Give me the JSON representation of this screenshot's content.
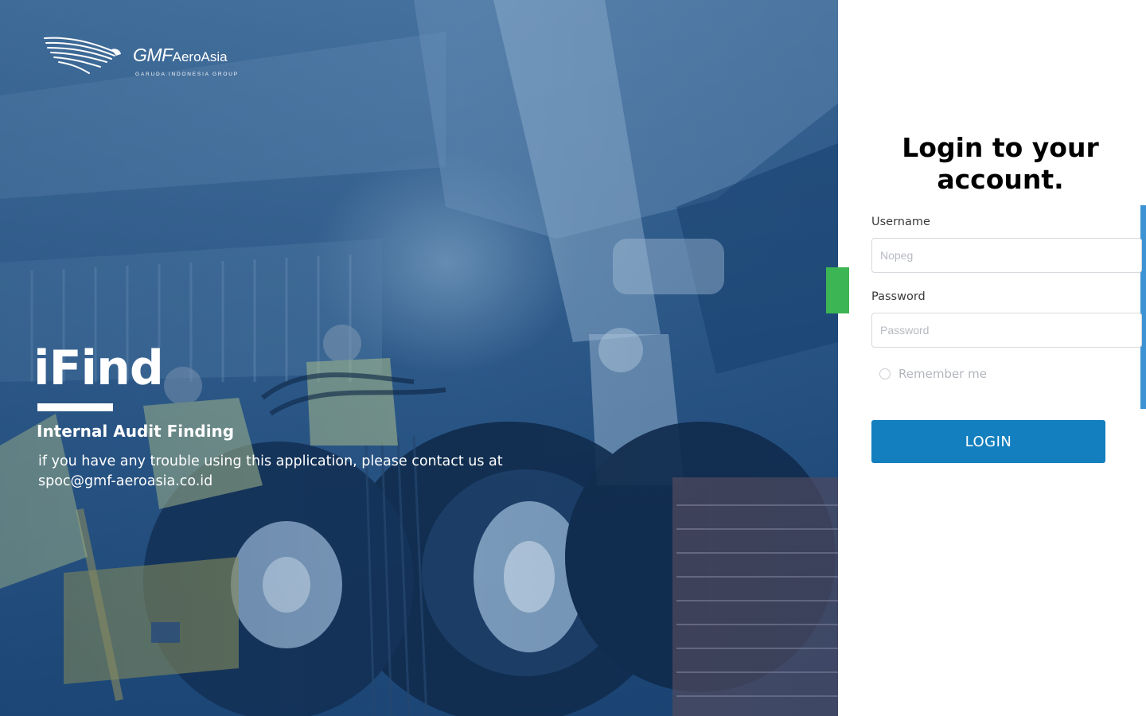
{
  "brand": {
    "logo_text_main": "GMF",
    "logo_text_secondary": "AeroAsia",
    "logo_tagline": "GARUDA INDONESIA GROUP"
  },
  "hero": {
    "app_name": "iFind",
    "subtitle": "Internal Audit Finding",
    "help_text": "if you have any trouble using this application, please contact us at spoc@gmf-aeroasia.co.id"
  },
  "login": {
    "heading": "Login to your account.",
    "username_label": "Username",
    "username_placeholder": "Nopeg",
    "username_value": "",
    "password_label": "Password",
    "password_placeholder": "Password",
    "password_value": "",
    "remember_label": "Remember me",
    "remember_checked": false,
    "submit_label": "LOGIN"
  },
  "colors": {
    "accent": "#137fbe",
    "scrollbar": "#3d93d4",
    "tab_green": "#3cb554",
    "hero_blue": "#2c5888"
  }
}
